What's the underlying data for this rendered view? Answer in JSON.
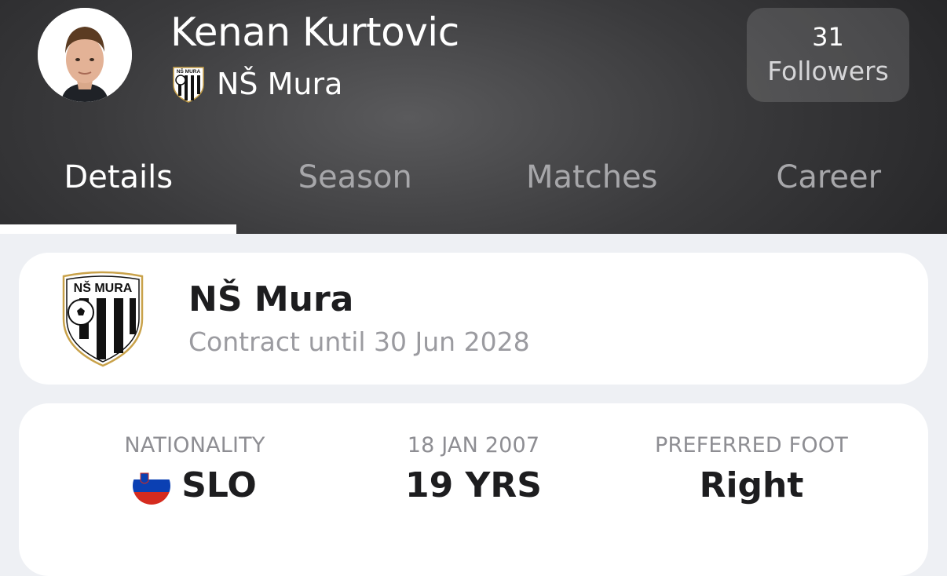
{
  "player": {
    "name": "Kenan Kurtovic",
    "club": "NŠ Mura",
    "followers_count": "31",
    "followers_label": "Followers"
  },
  "tabs": [
    {
      "label": "Details",
      "active": true
    },
    {
      "label": "Season",
      "active": false
    },
    {
      "label": "Matches",
      "active": false
    },
    {
      "label": "Career",
      "active": false
    }
  ],
  "club_card": {
    "name": "NŠ Mura",
    "contract": "Contract until 30 Jun 2028",
    "crest_text": "NŠ MURA"
  },
  "info": {
    "nationality_label": "NATIONALITY",
    "nationality_value": "SLO",
    "birth_label": "18 JAN 2007",
    "age_value": "19 YRS",
    "foot_label": "PREFERRED FOOT",
    "foot_value": "Right"
  },
  "colors": {
    "header_dark": "#2b2b2d",
    "background": "#eef0f4",
    "tab_inactive": "#a7a7aa",
    "text_primary": "#1d1d1f",
    "text_secondary": "#9b9ba0",
    "flag_white": "#ffffff",
    "flag_blue": "#0b40b3",
    "flag_red": "#d52b1e"
  },
  "icons": {
    "avatar": "player-photo",
    "club_crest": "ns-mura-crest-icon",
    "flag": "slovenia-flag-icon"
  }
}
